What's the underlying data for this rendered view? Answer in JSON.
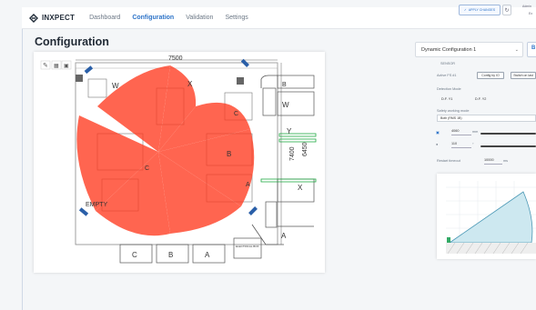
{
  "brand": {
    "name": "INXPECT",
    "logo_icon": "inxpect-logo-icon"
  },
  "nav": {
    "items": [
      {
        "label": "Dashboard",
        "active": false
      },
      {
        "label": "Configuration",
        "active": true
      },
      {
        "label": "Validation",
        "active": false
      },
      {
        "label": "Settings",
        "active": false
      }
    ]
  },
  "toolbar": {
    "apply_label": "APPLY CHANGES",
    "refresh_icon": "refresh-icon"
  },
  "user": {
    "name": "Admin",
    "sub": "Ex"
  },
  "page": {
    "title": "Configuration"
  },
  "plan": {
    "tools": [
      "pencil-icon",
      "grid-icon",
      "layers-icon"
    ],
    "dim_top": "7500",
    "dim_right_outer": "7400",
    "dim_right_inner": "6450",
    "labels": {
      "w_left": "W",
      "x_top": "X",
      "w_right": "W",
      "b_top": "B",
      "c_mid": "C",
      "y_right": "Y",
      "b_center": "B",
      "c_center": "C",
      "x_right": "X",
      "a_right": "A",
      "a_bottom_right": "A",
      "empty": "EMPTY",
      "c_bottom": "C",
      "b_bottom": "B",
      "a_bottom": "A",
      "electrical_box": "ELECTRICAL BOX"
    },
    "colors": {
      "zone": "#ff3b1f",
      "sensor": "#2a5fa8",
      "highlight": "#22aa44"
    }
  },
  "panel": {
    "config_select": "Dynamic Configuration 1",
    "sensor_heading": "SENSOR",
    "mode_label": "Active FS #1",
    "mode_buttons": [
      "Config by IO",
      "Switch on last"
    ],
    "detection_label": "Detection Mode",
    "detection_values": [
      "D.F. Y1",
      "D.F. Y2"
    ],
    "safety_label": "Safety working mode",
    "safety_value": "Both (RMS 1B)",
    "distance_value": "4060",
    "distance_unit": "mm",
    "angle_value": "110",
    "angle_unit": "°",
    "restart_label": "Restart timeout",
    "restart_value": "10000",
    "restart_unit": "ms"
  }
}
